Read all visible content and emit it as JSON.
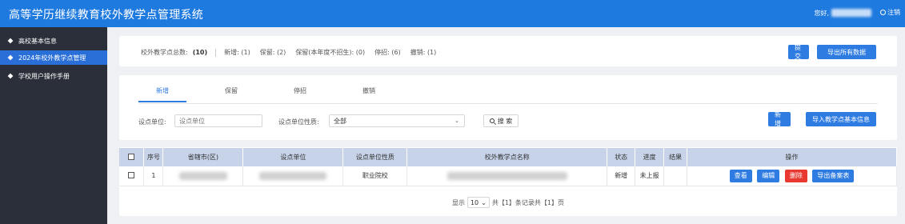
{
  "header": {
    "title": "高等学历继续教育校外教学点管理系统",
    "greeting": "您好,",
    "logout": "注销"
  },
  "sidebar": {
    "items": [
      {
        "label": "高校基本信息"
      },
      {
        "label": "2024年校外教学点管理"
      },
      {
        "label": "学校用户操作手册"
      }
    ]
  },
  "summary": {
    "total_label": "校外教学点总数:",
    "total_value": "(10)",
    "new": "新增: (1)",
    "keep": "保留: (2)",
    "keep_no_enroll": "保留(本年度不招生): (0)",
    "paused": "停招: (6)",
    "revoked": "撤销: (1)",
    "submit_label": "提交",
    "export_all_label": "导出所有数据"
  },
  "tabs": [
    "新增",
    "保留",
    "停招",
    "撤销"
  ],
  "filters": {
    "unit_label": "设点单位:",
    "unit_placeholder": "设点单位",
    "nature_label": "设点单位性质:",
    "nature_value": "全部",
    "search_label": "搜 索",
    "add_label": "新增",
    "import_label": "导入教学点基本信息"
  },
  "table": {
    "columns": [
      "序号",
      "省辖市(区)",
      "设点单位",
      "设点单位性质",
      "校外教学点名称",
      "状态",
      "进度",
      "结果",
      "操作"
    ],
    "rows": [
      {
        "index": "1",
        "nature": "职业院校",
        "status": "新增",
        "progress": "未上报",
        "result": ""
      }
    ],
    "actions": {
      "view": "查看",
      "edit": "编辑",
      "delete": "删除",
      "export": "导出备案表"
    }
  },
  "pager": {
    "show": "显示",
    "page_size": "10",
    "summary": "共【1】条记录共【1】页"
  },
  "colors": {
    "header": "#1f7ae0",
    "sidebar": "#2b2f3a",
    "sidebar_active": "#2a6fd8",
    "primary": "#2e7be2",
    "danger": "#e8382f"
  }
}
